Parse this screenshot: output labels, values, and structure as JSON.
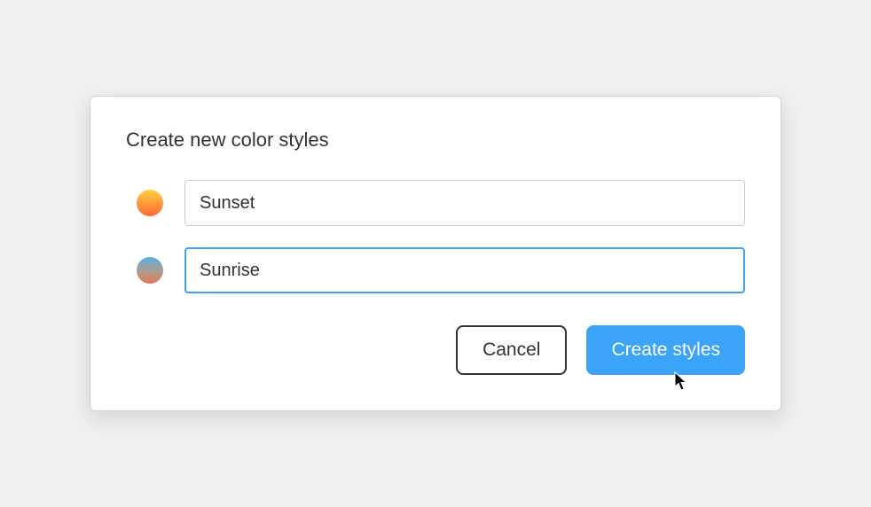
{
  "dialog": {
    "title": "Create new color styles",
    "rows": [
      {
        "swatch": "sunset",
        "name": "Sunset",
        "focused": false
      },
      {
        "swatch": "sunrise",
        "name": "Sunrise",
        "focused": true
      }
    ],
    "buttons": {
      "cancel": "Cancel",
      "create": "Create styles"
    }
  }
}
